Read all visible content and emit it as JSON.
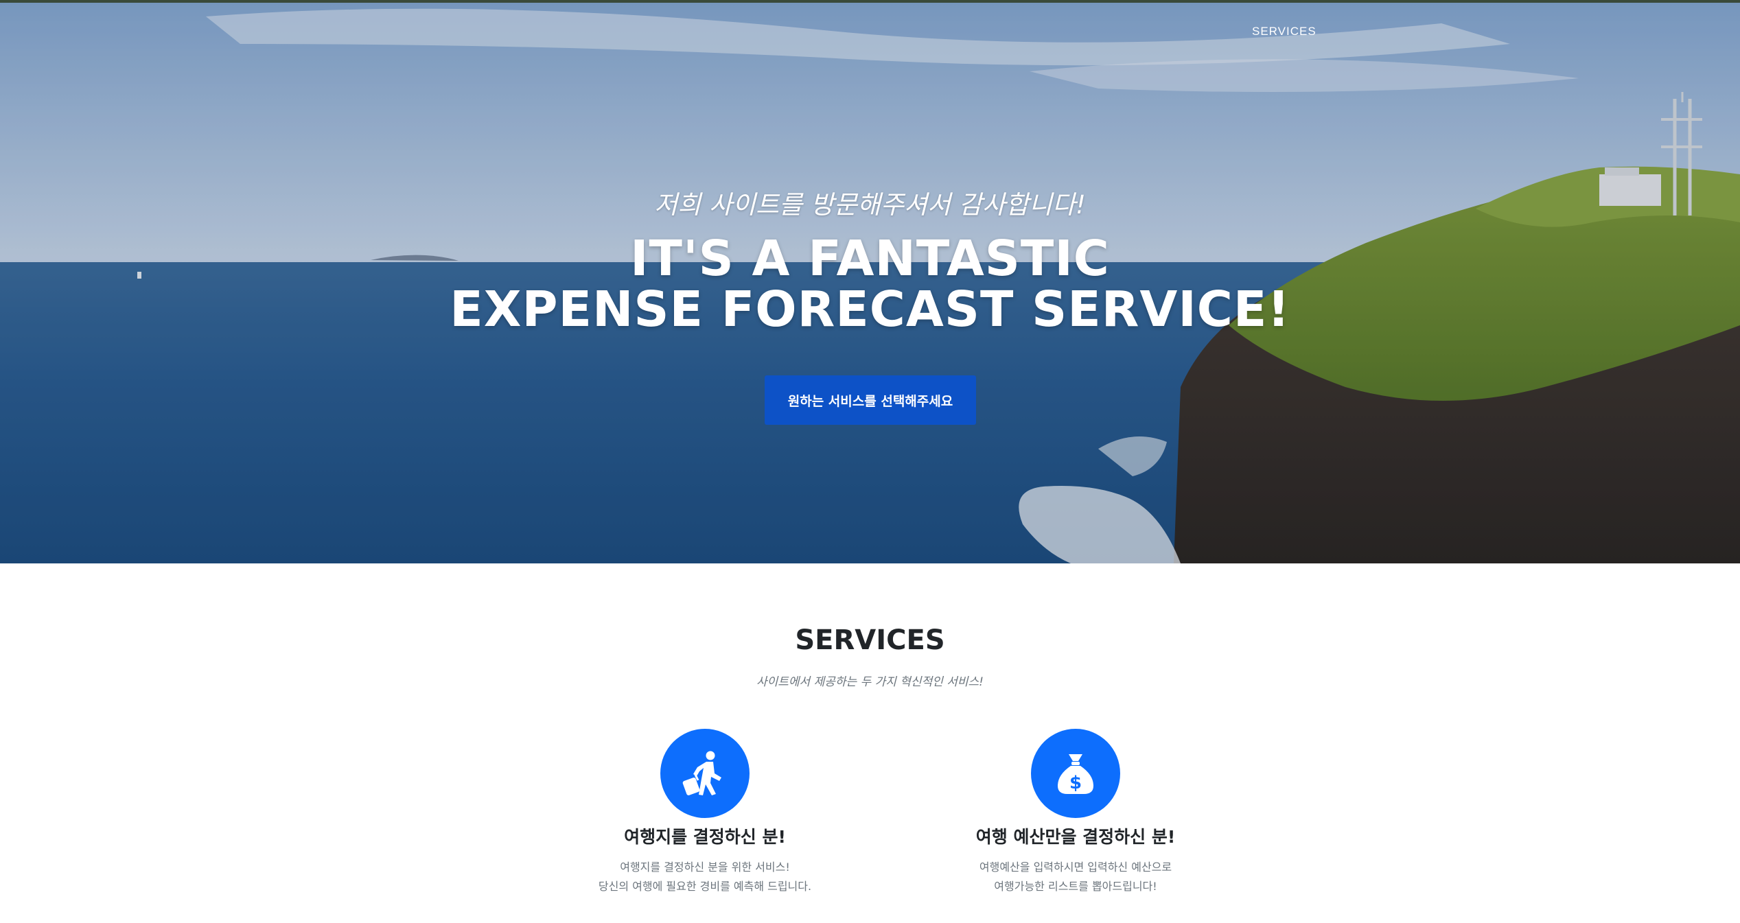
{
  "nav": {
    "services_link": "SERVICES"
  },
  "hero": {
    "subtitle": "저희 사이트를 방문해주셔서 감사합니다!",
    "title_line1": "IT'S A FANTASTIC",
    "title_line2": "EXPENSE FORECAST SERVICE!",
    "button_label": "원하는 서비스를 선택해주세요"
  },
  "services": {
    "heading": "SERVICES",
    "subheading": "사이트에서 제공하는 두 가지 혁신적인 서비스!",
    "items": [
      {
        "icon": "person-walking-luggage-icon",
        "title": "여행지를 결정하신 분!",
        "desc_line1": "여행지를 결정하신 분을 위한 서비스!",
        "desc_line2": "당신의 여행에 필요한 경비를 예측해 드립니다."
      },
      {
        "icon": "money-bag-dollar-icon",
        "title": "여행 예산만을 결정하신 분!",
        "desc_line1": "여행예산을 입력하시면 입력하신 예산으로",
        "desc_line2": "여행가능한 리스트를 뽑아드립니다!"
      }
    ]
  },
  "colors": {
    "primary_button": "#0d52c7",
    "icon_circle": "#0d6efd",
    "heading_text": "#212529",
    "muted_text": "#6c757d"
  }
}
